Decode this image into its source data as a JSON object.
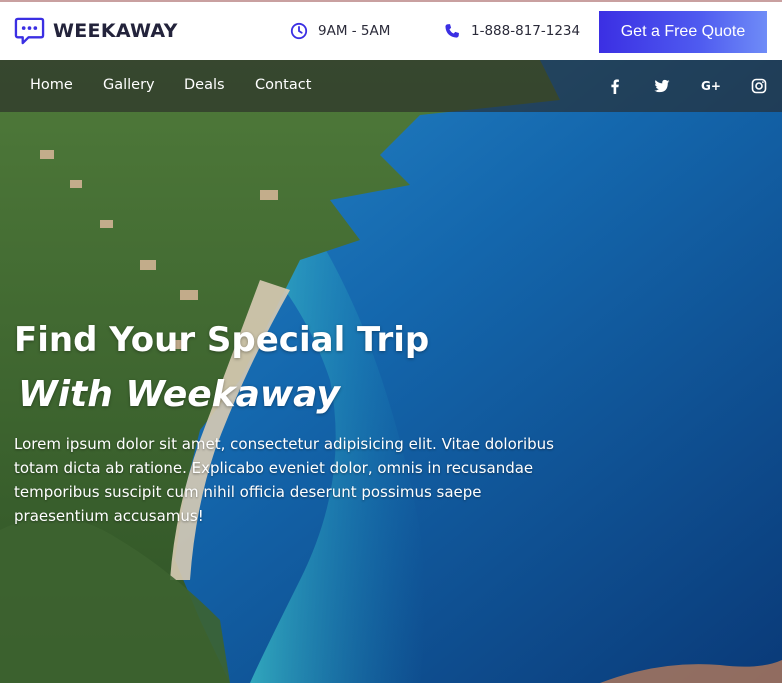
{
  "brand": {
    "name": "WEEKAWAY",
    "logo_icon": "chat-bubble-icon",
    "accent": "#3b2fe3"
  },
  "header": {
    "hours": {
      "icon": "clock-icon",
      "text": "9AM - 5AM"
    },
    "phone": {
      "icon": "phone-icon",
      "text": "1-888-817-1234"
    },
    "cta_label": "Get a Free Quote"
  },
  "nav": {
    "items": [
      {
        "label": "Home"
      },
      {
        "label": "Gallery"
      },
      {
        "label": "Deals"
      },
      {
        "label": "Contact"
      }
    ],
    "social": [
      {
        "icon": "facebook-icon"
      },
      {
        "icon": "twitter-icon"
      },
      {
        "icon": "google-plus-icon",
        "label": "G+"
      },
      {
        "icon": "instagram-icon"
      }
    ]
  },
  "hero": {
    "title": "Find Your Special Trip",
    "subtitle": "With Weekaway",
    "body": "Lorem ipsum dolor sit amet, consectetur adipisicing elit. Vitae doloribus totam dicta ab ratione. Explicabo eveniet dolor, omnis in recusandae temporibus suscipit cum nihil officia deserunt possimus saepe praesentium accusamus!",
    "image": "coastal-bay-landscape-image"
  }
}
